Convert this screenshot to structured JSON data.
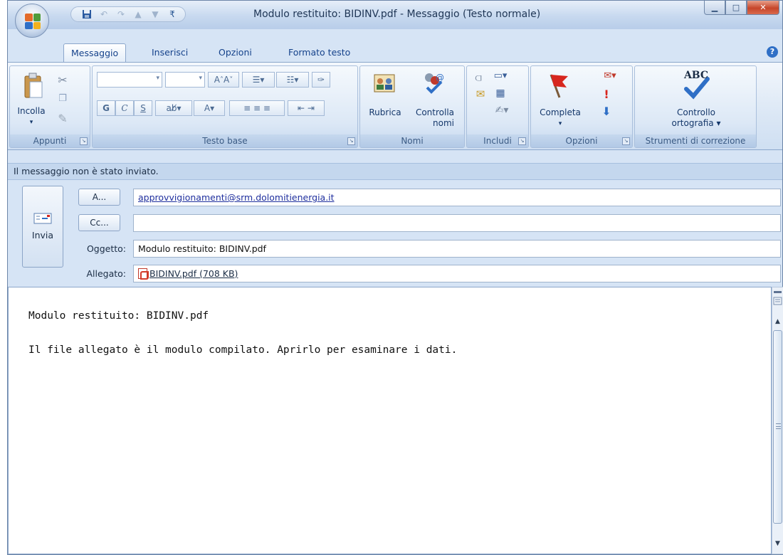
{
  "window": {
    "title": "Modulo restituito: BIDINV.pdf - Messaggio (Testo normale)"
  },
  "tabs": [
    {
      "label": "Messaggio",
      "active": true
    },
    {
      "label": "Inserisci",
      "active": false
    },
    {
      "label": "Opzioni",
      "active": false
    },
    {
      "label": "Formato testo",
      "active": false
    }
  ],
  "ribbon": {
    "appunti": {
      "label": "Appunti",
      "paste_label": "Incolla"
    },
    "testo_base": {
      "label": "Testo base",
      "bold": "G",
      "italic": "C",
      "underline": "S"
    },
    "nomi": {
      "label": "Nomi",
      "rubrica": "Rubrica",
      "controlla_line1": "Controlla",
      "controlla_line2": "nomi"
    },
    "includi": {
      "label": "Includi"
    },
    "opzioni": {
      "label": "Opzioni",
      "completa": "Completa"
    },
    "strumenti": {
      "label": "Strumenti di correzione",
      "abc": "ABC",
      "controllo_line1": "Controllo",
      "controllo_line2": "ortografia ▾"
    }
  },
  "infobar": {
    "text": "Il messaggio non è stato inviato."
  },
  "header": {
    "send_label": "Invia",
    "to_button": "A...",
    "cc_button": "Cc...",
    "to_value": "approvvigionamenti@srm.dolomitienergia.it",
    "cc_value": "",
    "subject_label": "Oggetto:",
    "subject_value": "Modulo restituito: BIDINV.pdf",
    "attachment_label": "Allegato:",
    "attachment_value": "BIDINV.pdf (708 KB)"
  },
  "body": {
    "line1": "Modulo restituito: BIDINV.pdf",
    "line2": "Il file allegato è il modulo compilato. Aprirlo per esaminare i dati."
  },
  "colors": {
    "ribbon_bg": "#dbe7f5",
    "link": "#1f2f9e",
    "close_button": "#c6462a"
  }
}
